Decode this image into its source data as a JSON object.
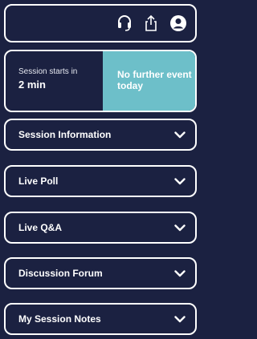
{
  "header": {
    "icons": [
      "headset-icon",
      "share-icon",
      "account-icon"
    ]
  },
  "session": {
    "starts_label": "Session starts in",
    "starts_value": "2 min",
    "next_event": "No further event today",
    "accent_color": "#6dbfc9"
  },
  "sections": [
    {
      "label": "Session Information"
    },
    {
      "label": "Live Poll"
    },
    {
      "label": "Live Q&A"
    },
    {
      "label": "Discussion Forum"
    },
    {
      "label": "My Session Notes"
    }
  ],
  "colors": {
    "background": "#1b2141",
    "border": "#ffffff"
  }
}
